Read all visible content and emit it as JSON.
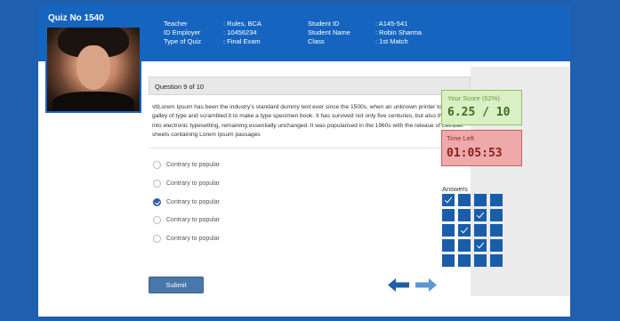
{
  "header": {
    "title": "Quiz No 1540",
    "left_info": [
      {
        "label": "Teacher",
        "value": ": Rules, BCA"
      },
      {
        "label": "ID Employer",
        "value": ": 10456234"
      },
      {
        "label": "Type of Quiz",
        "value": ": Final Exam"
      }
    ],
    "right_info": [
      {
        "label": "Student ID",
        "value": ": A145-541"
      },
      {
        "label": "Student Name",
        "value": ": Robin Sharma"
      },
      {
        "label": "Class",
        "value": ": 1st Match"
      }
    ]
  },
  "question": {
    "heading": "Question 9 of 10",
    "text": "vttLorem Ipsum has been the industry's standard dummy text ever since the 1500s, when an unknown printer took a galley of type and scrambled it to make a type specimen book. It has survived not only five centuries, but also the leap into electronic typesetting, remaining essentially unchanged. It was popularised in the 1960s with the release of Letraset sheets containing Lorem Ipsum passages",
    "options": [
      {
        "label": "Contrary to popular",
        "selected": false
      },
      {
        "label": "Contrary to popular",
        "selected": false
      },
      {
        "label": "Contrary to popular",
        "selected": true
      },
      {
        "label": "Contrary to popular",
        "selected": false
      },
      {
        "label": "Contrary to popular",
        "selected": false
      }
    ]
  },
  "actions": {
    "submit_label": "Submit",
    "prev_icon": "arrow-left-icon",
    "next_icon": "arrow-right-icon"
  },
  "sidebar": {
    "score_label": "Your Score (62%)",
    "score_value": "6.25 / 10",
    "time_label": "Time Left",
    "time_value": "01:05:53",
    "answers_label": "Answers",
    "answers_grid": [
      [
        true,
        false,
        false,
        false
      ],
      [
        false,
        false,
        true,
        false
      ],
      [
        false,
        true,
        false,
        false
      ],
      [
        false,
        false,
        true,
        false
      ],
      [
        false,
        false,
        false,
        false
      ]
    ]
  },
  "colors": {
    "brand_blue": "#1565c0",
    "score_green": "#d8f0c4",
    "timer_red": "#eeaaaa"
  }
}
